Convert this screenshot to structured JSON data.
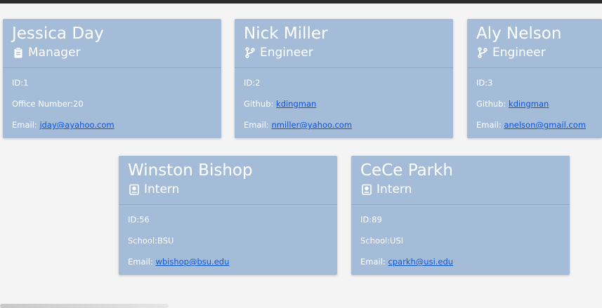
{
  "team": [
    {
      "name": "Jessica Day",
      "role": "Manager",
      "role_icon": "clipboard-icon",
      "id_label": "ID:1",
      "extra_label": "Office Number:20",
      "extra_link": "",
      "email_prefix": "Email: ",
      "email": "jday@ayahoo.com"
    },
    {
      "name": "Nick Miller",
      "role": "Engineer",
      "role_icon": "code-branch-icon",
      "id_label": "ID:2",
      "extra_label": "Github: ",
      "extra_link": "kdingman",
      "email_prefix": "Email: ",
      "email": "nmiller@yahoo.com"
    },
    {
      "name": "Aly Nelson",
      "role": "Engineer",
      "role_icon": "code-branch-icon",
      "id_label": "ID:3",
      "extra_label": "Github: ",
      "extra_link": "kdingman",
      "email_prefix": "Email: ",
      "email": "anelson@gmail.com"
    },
    {
      "name": "Winston Bishop",
      "role": "Intern",
      "role_icon": "id-badge-icon",
      "id_label": "ID:56",
      "extra_label": "School:BSU",
      "extra_link": "",
      "email_prefix": "Email: ",
      "email": "wbishop@bsu.edu"
    },
    {
      "name": "CeCe Parkh",
      "role": "Intern",
      "role_icon": "id-badge-icon",
      "id_label": "ID:89",
      "extra_label": "School:USI",
      "extra_link": "",
      "email_prefix": "Email: ",
      "email": "cparkh@usi.edu"
    }
  ],
  "colors": {
    "page_background": "#f4f4f4",
    "card_background": "#a4bcd8",
    "card_text": "#ffffff",
    "link": "#0b55d6"
  }
}
